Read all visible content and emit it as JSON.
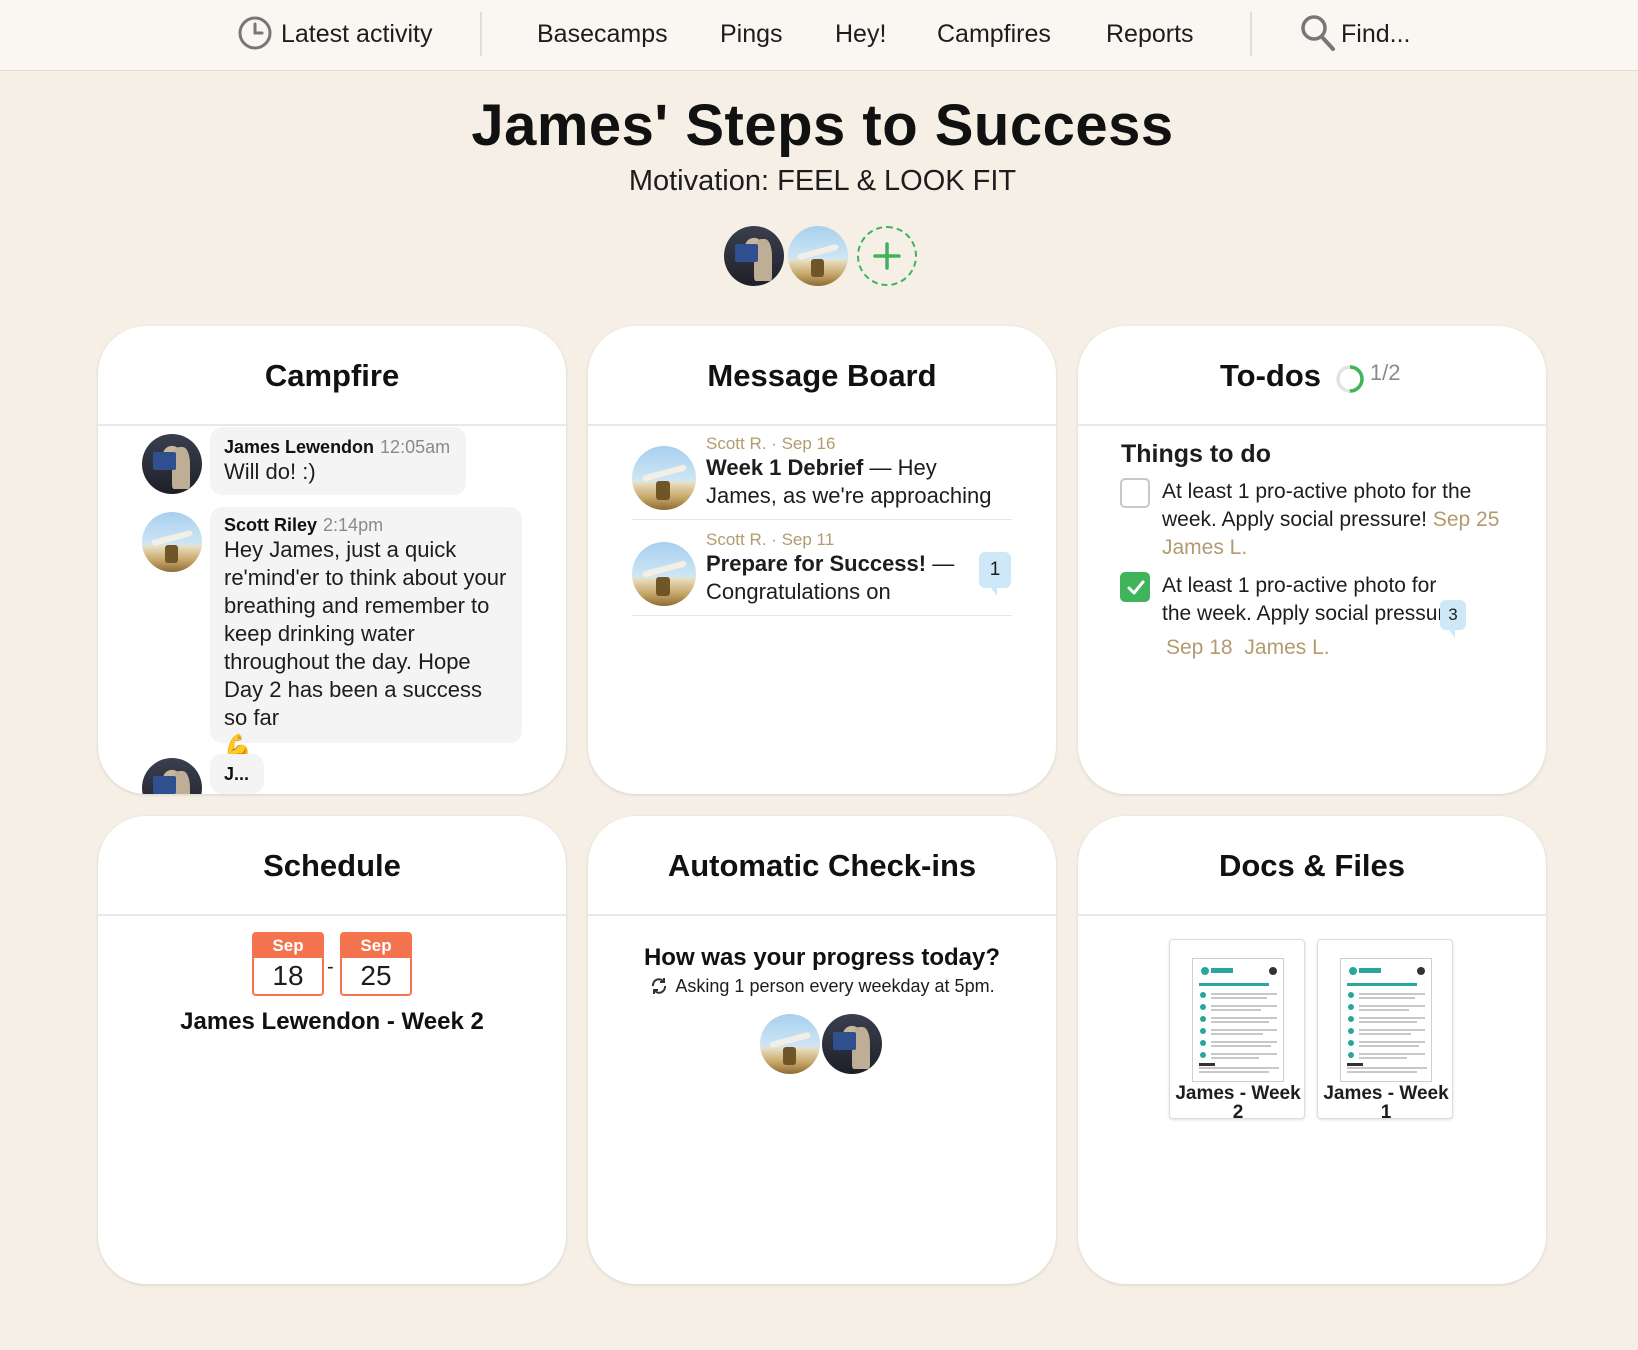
{
  "nav": {
    "latest_activity": "Latest activity",
    "basecamps": "Basecamps",
    "pings": "Pings",
    "hey": "Hey!",
    "campfires": "Campfires",
    "reports": "Reports",
    "find": "Find..."
  },
  "project": {
    "title": "James' Steps to Success",
    "subtitle": "Motivation: FEEL & LOOK FIT"
  },
  "campfire": {
    "title": "Campfire",
    "messages": [
      {
        "name": "James Lewendon",
        "time": "12:05am",
        "text": "Will do! :)"
      },
      {
        "name": "Scott Riley",
        "time": "2:14pm",
        "text": "Hey James, just a quick re'mind'er to think about your breathing and remember to keep drinking water throughout the day. Hope Day 2 has been a success so far"
      },
      {
        "name": "J..."
      }
    ],
    "emoji": "💪"
  },
  "message_board": {
    "title": "Message Board",
    "items": [
      {
        "meta": "Scott R. · Sep 16",
        "subject": "Week 1 Debrief",
        "preview": " — Hey James, as we're approaching the end of"
      },
      {
        "meta": "Scott R. · Sep 11",
        "subject": "Prepare for Success!",
        "preview": " — Congratulations on",
        "comments": "1"
      }
    ]
  },
  "todos": {
    "title": "To-dos",
    "progress": "1/2",
    "progress_fraction": 0.5,
    "list_title": "Things to do",
    "items": [
      {
        "text": "At least 1 pro-active photo for the week. Apply social pressure!",
        "due": "Sep 25",
        "assignee": "James L.",
        "checked": false
      },
      {
        "text": "At least 1 pro-active photo for the week. Apply social pressure!",
        "comments": "3",
        "due": "Sep 18",
        "assignee": "James L.",
        "checked": true
      }
    ]
  },
  "schedule": {
    "title": "Schedule",
    "start": {
      "month": "Sep",
      "day": "18"
    },
    "end": {
      "month": "Sep",
      "day": "25"
    },
    "separator": "-",
    "event": "James Lewendon - Week 2"
  },
  "checkins": {
    "title": "Automatic Check-ins",
    "question": "How was your progress today?",
    "schedule": "Asking 1 person every weekday at 5pm."
  },
  "docs": {
    "title": "Docs & Files",
    "files": [
      {
        "label": "James - Week 2"
      },
      {
        "label": "James - Week 1"
      }
    ]
  },
  "colors": {
    "background": "#f5efe5",
    "green": "#3fb45a",
    "orange": "#f2734e",
    "meta": "#b49a6f",
    "badge": "#cfe8f7"
  }
}
